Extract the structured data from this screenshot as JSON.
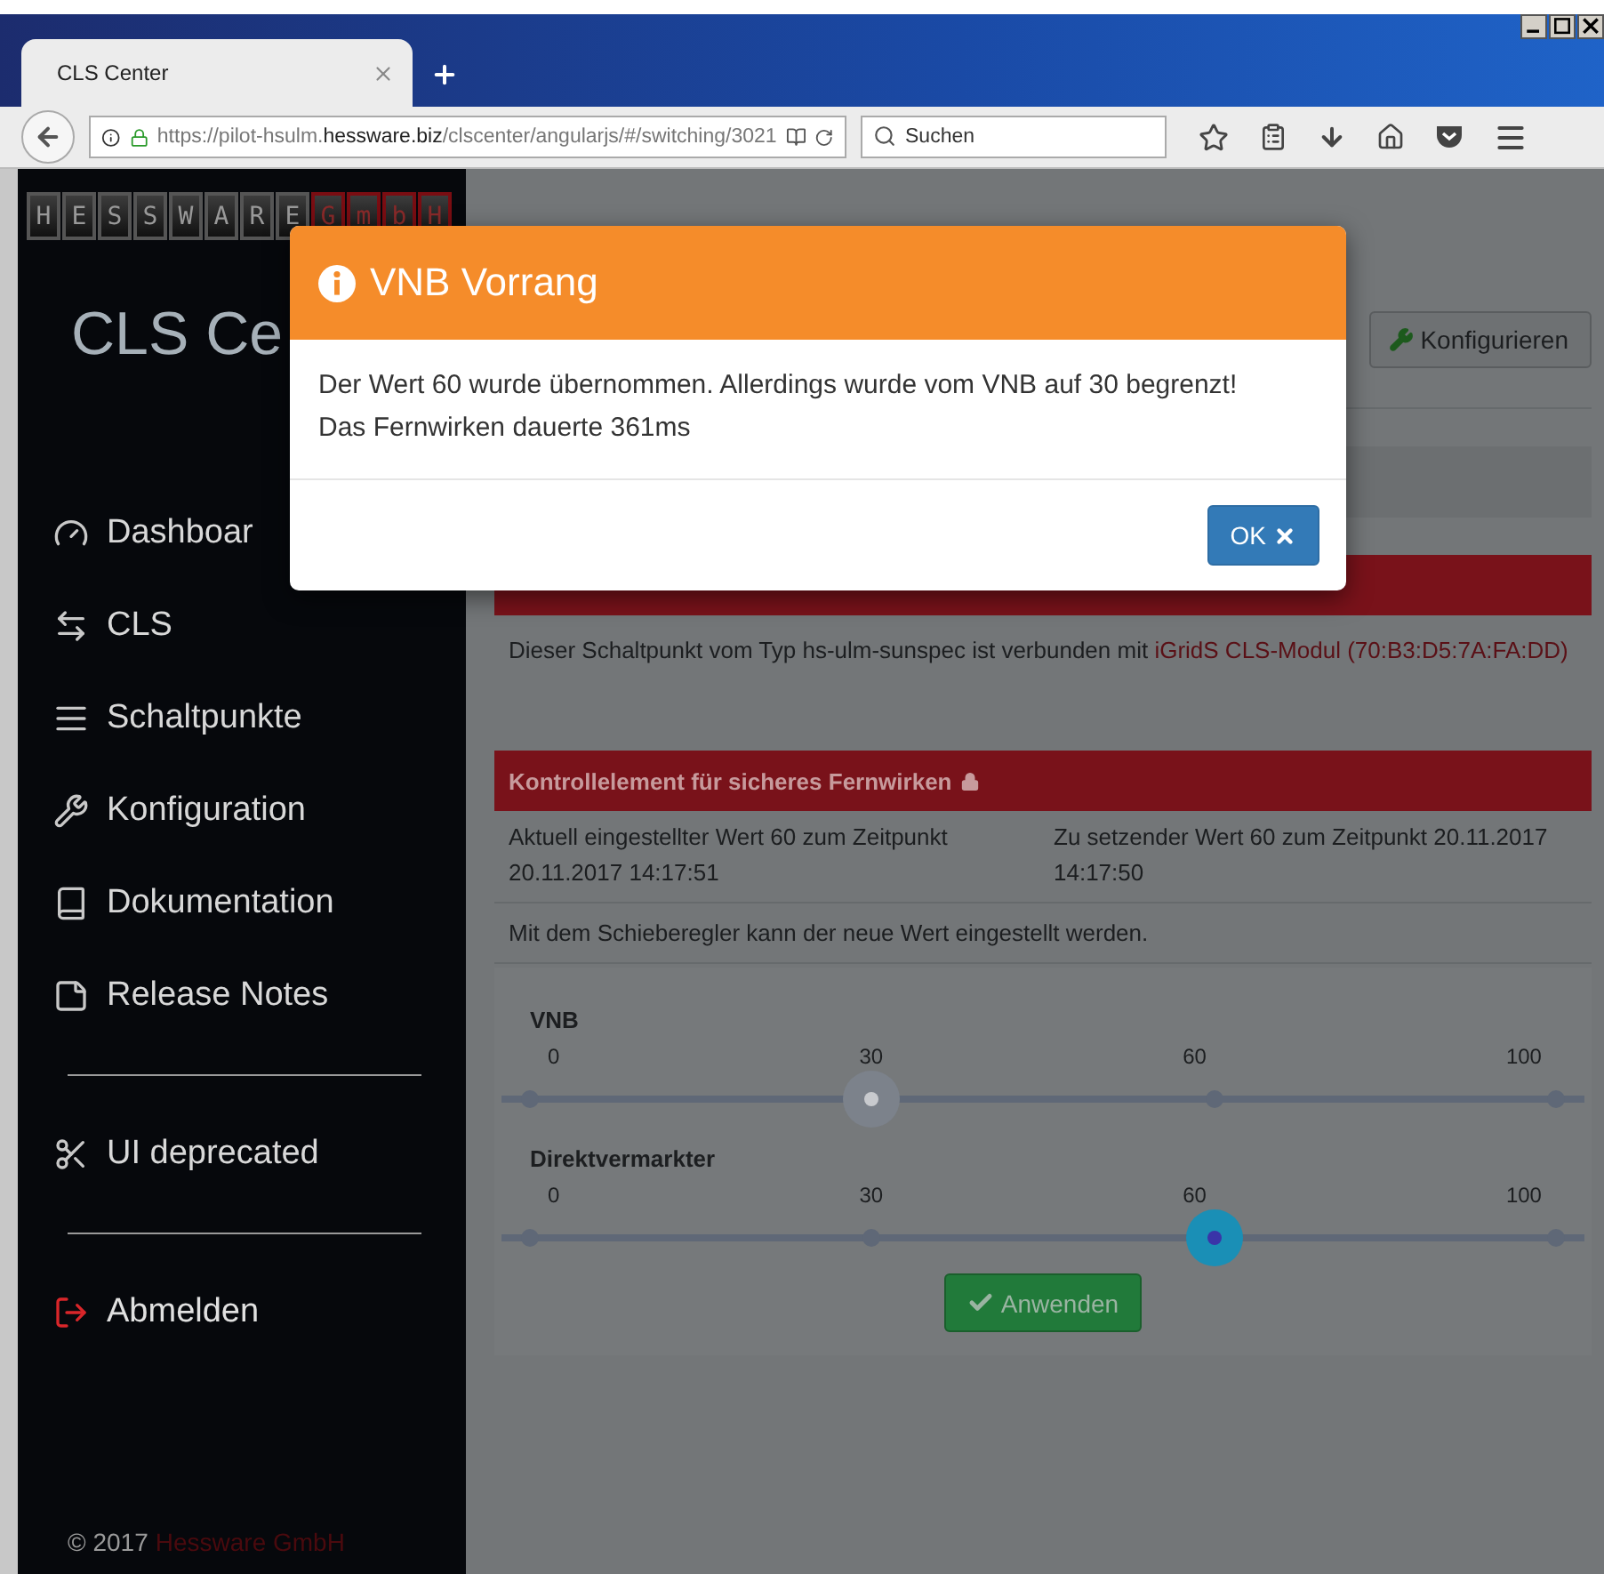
{
  "browser": {
    "tab": {
      "title": "CLS Center"
    },
    "url": "https://pilot-hsulm.**hessware.biz**/clscenter/angularjs/#/switching/3021",
    "search": {
      "placeholder": "Suchen"
    }
  },
  "sidebar": {
    "logo": [
      {
        "char": "H",
        "accent": false
      },
      {
        "char": "E",
        "accent": false
      },
      {
        "char": "S",
        "accent": false
      },
      {
        "char": "S",
        "accent": false
      },
      {
        "char": "W",
        "accent": false
      },
      {
        "char": "A",
        "accent": false
      },
      {
        "char": "R",
        "accent": false
      },
      {
        "char": "E",
        "accent": false
      },
      {
        "char": "G",
        "accent": true
      },
      {
        "char": "m",
        "accent": true
      },
      {
        "char": "b",
        "accent": true
      },
      {
        "char": "H",
        "accent": true
      }
    ],
    "title": "CLS Ce",
    "nav_groups": [
      [
        {
          "label": "Dashboar",
          "kind": "default"
        },
        {
          "label": "CLS",
          "kind": "default"
        },
        {
          "label": "Schaltpunkte",
          "kind": "default"
        },
        {
          "label": "Konfiguration",
          "kind": "default"
        },
        {
          "label": "Dokumentation",
          "kind": "default"
        },
        {
          "label": "Release Notes",
          "kind": "default"
        }
      ],
      [
        {
          "label": "UI deprecated",
          "kind": "default"
        }
      ],
      [
        {
          "label": "Abmelden",
          "kind": "danger"
        }
      ]
    ],
    "footer": {
      "copyright": "© 2017",
      "company": "Hessware GmbH"
    }
  },
  "main": {
    "configure_button": "Konfigurieren",
    "device_info": {
      "text": "Dieser Schaltpunkt vom Typ hs-ulm-sunspec ist verbunden mit ",
      "link": "iGridS CLS-Modul (70:B3:D5:7A:FA:DD)"
    },
    "control_panel": {
      "title": "Kontrollelement für sicheres Fernwirken",
      "current": "Aktuell eingestellter Wert 60 zum Zeitpunkt 20.11.2017 14:17:51",
      "target": "Zu setzender Wert 60 zum Zeitpunkt 20.11.2017 14:17:50",
      "hint": "Mit dem Schieberegler kann der neue Wert eingestellt werden.",
      "sliders": [
        {
          "label": "VNB",
          "ticks": [
            "0",
            "30",
            "60",
            "100"
          ],
          "level": 0.333,
          "disabled": true
        },
        {
          "label": "Direktvermarkter",
          "ticks": [
            "0",
            "30",
            "60",
            "100"
          ],
          "level": 0.667,
          "disabled": false
        }
      ],
      "apply_button": "Anwenden"
    }
  },
  "dialog": {
    "title": "VNB Vorrang",
    "message_lines": [
      "Der Wert 60 wurde übernommen. Allerdings wurde vom VNB auf 30 begrenzt!",
      "Das Fernwirken dauerte 361ms"
    ],
    "ok_button": "OK"
  }
}
